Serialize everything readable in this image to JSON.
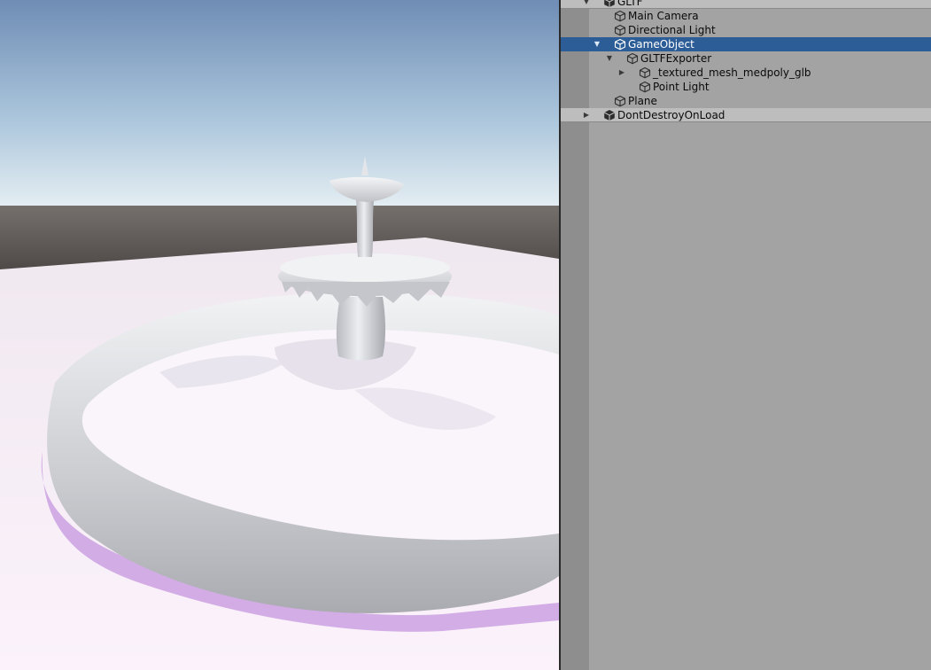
{
  "colors": {
    "selection": "#2c5d97",
    "hierarchy_bg": "#a3a3a3",
    "sky_top": "#6f8db5",
    "sky_horizon": "#d8e6ef",
    "ground": "#5b5654",
    "plane": "#f5ecf5",
    "mesh": "#e6e7eb"
  },
  "hierarchy": {
    "rows": [
      {
        "label": "GLTF",
        "depth": 0,
        "foldout": "expanded",
        "icon": "unity-scene-icon",
        "kind": "scene"
      },
      {
        "label": "Main Camera",
        "depth": 1,
        "foldout": "none",
        "icon": "gameobject-cube-icon"
      },
      {
        "label": "Directional Light",
        "depth": 1,
        "foldout": "none",
        "icon": "gameobject-cube-icon"
      },
      {
        "label": "GameObject",
        "depth": 1,
        "foldout": "expanded",
        "icon": "gameobject-cube-icon",
        "selected": true
      },
      {
        "label": "GLTFExporter",
        "depth": 2,
        "foldout": "expanded",
        "icon": "gameobject-cube-icon"
      },
      {
        "label": "_textured_mesh_medpoly_glb",
        "depth": 3,
        "foldout": "collapsed",
        "icon": "gameobject-cube-icon"
      },
      {
        "label": "Point Light",
        "depth": 3,
        "foldout": "none",
        "icon": "gameobject-cube-icon"
      },
      {
        "label": "Plane",
        "depth": 1,
        "foldout": "none",
        "icon": "gameobject-cube-icon"
      },
      {
        "label": "DontDestroyOnLoad",
        "depth": 0,
        "foldout": "collapsed",
        "icon": "unity-scene-icon",
        "kind": "scene"
      }
    ]
  }
}
